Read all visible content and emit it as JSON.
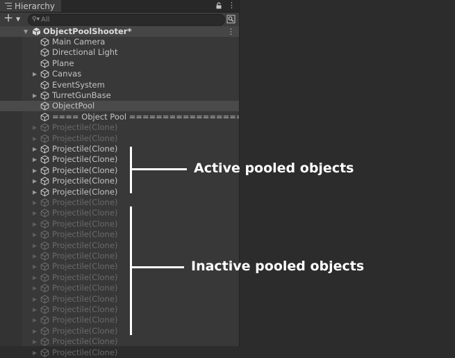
{
  "tab": {
    "title": "Hierarchy"
  },
  "toolbar": {
    "search_placeholder": "All"
  },
  "scene": {
    "name": "ObjectPoolShooter*"
  },
  "items": [
    {
      "label": "Main Camera",
      "expandable": false,
      "state": "normal"
    },
    {
      "label": "Directional Light",
      "expandable": false,
      "state": "normal"
    },
    {
      "label": "Plane",
      "expandable": false,
      "state": "normal"
    },
    {
      "label": "Canvas",
      "expandable": true,
      "state": "normal"
    },
    {
      "label": "EventSystem",
      "expandable": false,
      "state": "normal"
    },
    {
      "label": "TurretGunBase",
      "expandable": true,
      "state": "normal"
    },
    {
      "label": "ObjectPool",
      "expandable": false,
      "state": "selected"
    },
    {
      "label": "==== Object Pool ====================",
      "expandable": false,
      "state": "normal"
    },
    {
      "label": "Projectile(Clone)",
      "expandable": true,
      "state": "inactive"
    },
    {
      "label": "Projectile(Clone)",
      "expandable": true,
      "state": "inactive"
    },
    {
      "label": "Projectile(Clone)",
      "expandable": true,
      "state": "active"
    },
    {
      "label": "Projectile(Clone)",
      "expandable": true,
      "state": "active"
    },
    {
      "label": "Projectile(Clone)",
      "expandable": true,
      "state": "active"
    },
    {
      "label": "Projectile(Clone)",
      "expandable": true,
      "state": "active"
    },
    {
      "label": "Projectile(Clone)",
      "expandable": true,
      "state": "active"
    },
    {
      "label": "Projectile(Clone)",
      "expandable": true,
      "state": "inactive"
    },
    {
      "label": "Projectile(Clone)",
      "expandable": true,
      "state": "inactive"
    },
    {
      "label": "Projectile(Clone)",
      "expandable": true,
      "state": "inactive"
    },
    {
      "label": "Projectile(Clone)",
      "expandable": true,
      "state": "inactive"
    },
    {
      "label": "Projectile(Clone)",
      "expandable": true,
      "state": "inactive"
    },
    {
      "label": "Projectile(Clone)",
      "expandable": true,
      "state": "inactive"
    },
    {
      "label": "Projectile(Clone)",
      "expandable": true,
      "state": "inactive"
    },
    {
      "label": "Projectile(Clone)",
      "expandable": true,
      "state": "inactive"
    },
    {
      "label": "Projectile(Clone)",
      "expandable": true,
      "state": "inactive"
    },
    {
      "label": "Projectile(Clone)",
      "expandable": true,
      "state": "inactive"
    },
    {
      "label": "Projectile(Clone)",
      "expandable": true,
      "state": "inactive"
    },
    {
      "label": "Projectile(Clone)",
      "expandable": true,
      "state": "inactive"
    },
    {
      "label": "Projectile(Clone)",
      "expandable": true,
      "state": "inactive"
    },
    {
      "label": "Projectile(Clone)",
      "expandable": true,
      "state": "inactive"
    },
    {
      "label": "Projectile(Clone)",
      "expandable": true,
      "state": "inactive"
    }
  ],
  "annotations": {
    "active": "Active pooled objects",
    "inactive": "Inactive pooled objects"
  },
  "icons": {
    "tab": "hierarchy-list-icon",
    "lock": "lock-icon",
    "more": "more-vertical-icon",
    "add": "plus-icon",
    "search": "search-icon",
    "scene_visibility": "scene-search-icon",
    "scene": "unity-scene-icon",
    "gameobject": "cube-icon"
  },
  "colors": {
    "panel_bg": "#383838",
    "text_normal": "#c4c4c4",
    "text_inactive": "#6a6a6a",
    "selected_row": "#4a4a4a",
    "annotation": "#ffffff"
  }
}
